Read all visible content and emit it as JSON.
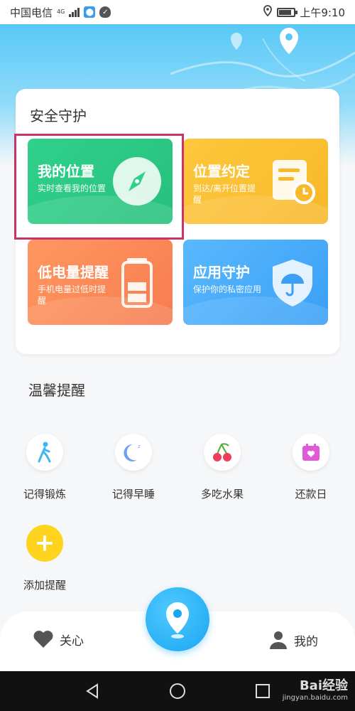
{
  "status_bar": {
    "carrier": "中国电信",
    "network": "4G",
    "time": "上午9:10"
  },
  "safety": {
    "title": "安全守护",
    "tiles": [
      {
        "title": "我的位置",
        "subtitle": "实时查看我的位置",
        "icon": "compass-icon",
        "color": "#2fd18a"
      },
      {
        "title": "位置约定",
        "subtitle": "到达/离开位置提醒",
        "icon": "note-clock-icon",
        "color": "#ffc73c"
      },
      {
        "title": "低电量提醒",
        "subtitle": "手机电量过低时提醒",
        "icon": "battery-icon",
        "color": "#ff9760"
      },
      {
        "title": "应用守护",
        "subtitle": "保护你的私密应用",
        "icon": "shield-umbrella-icon",
        "color": "#59b9ff"
      }
    ]
  },
  "reminders": {
    "title": "温馨提醒",
    "items": [
      {
        "label": "记得锻炼",
        "icon": "walking-icon",
        "color": "#3fb6f0"
      },
      {
        "label": "记得早睡",
        "icon": "moon-sleep-icon",
        "color": "#6f9ff5"
      },
      {
        "label": "多吃水果",
        "icon": "cherry-icon",
        "color": "#ef3e5c"
      },
      {
        "label": "还款日",
        "icon": "calendar-heart-icon",
        "color": "#e05ad8"
      },
      {
        "label": "添加提醒",
        "icon": "plus-icon",
        "color": "#ffd41f"
      }
    ]
  },
  "bottom_nav": {
    "left_label": "关心",
    "right_label": "我的"
  },
  "watermark": {
    "text": "Bai经验",
    "url_text": "jingyan.baidu.com"
  }
}
